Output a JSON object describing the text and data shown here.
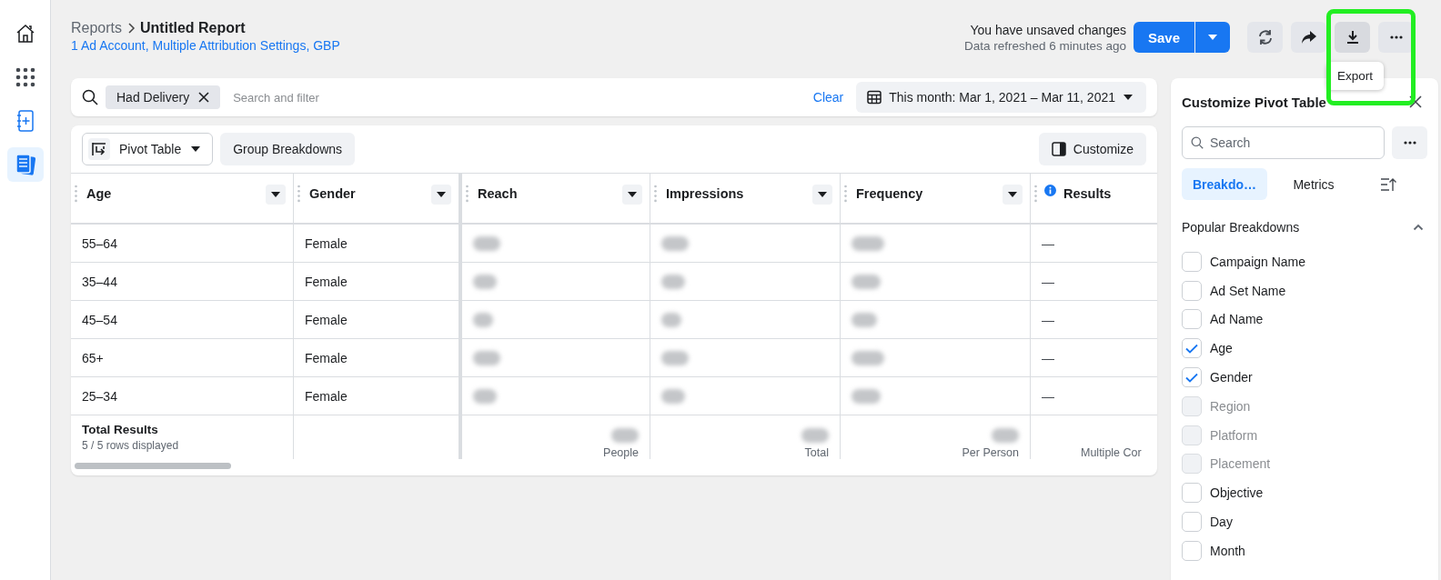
{
  "nav": [
    {
      "kind": "home",
      "selected": false
    },
    {
      "kind": "apps",
      "selected": false
    },
    {
      "kind": "notebook",
      "selected": false
    },
    {
      "kind": "reports",
      "selected": true
    }
  ],
  "header": {
    "breadcrumb_parent": "Reports",
    "breadcrumb_current": "Untitled Report",
    "subtitle": "1 Ad Account, Multiple Attribution Settings, GBP",
    "status": "You have unsaved changes",
    "refreshed": "Data refreshed 6 minutes ago",
    "save_button": "Save",
    "tooltip": "Export",
    "export_highlighted": true
  },
  "filter_bar": {
    "chip": "Had Delivery",
    "placeholder": "Search and filter",
    "clear": "Clear",
    "date_range": "This month: Mar 1, 2021 – Mar 11, 2021"
  },
  "toolbar": {
    "view": "Pivot Table",
    "group": "Group Breakdowns",
    "customize": "Customize"
  },
  "table": {
    "columns": [
      {
        "label": "Age",
        "info": false,
        "sortable": true
      },
      {
        "label": "Gender",
        "info": false,
        "sortable": true
      },
      {
        "label": "Reach",
        "info": false,
        "sortable": true
      },
      {
        "label": "Impressions",
        "info": false,
        "sortable": true
      },
      {
        "label": "Frequency",
        "info": false,
        "sortable": true
      },
      {
        "label": "Results",
        "info": true,
        "sortable": false
      }
    ],
    "rows": [
      {
        "cells": [
          {
            "kind": "text",
            "text": "55–64"
          },
          {
            "kind": "text",
            "text": "Female"
          },
          {
            "kind": "blurred"
          },
          {
            "kind": "blurred"
          },
          {
            "kind": "blurred"
          },
          {
            "kind": "text",
            "text": "—"
          }
        ]
      },
      {
        "cells": [
          {
            "kind": "text",
            "text": "35–44"
          },
          {
            "kind": "text",
            "text": "Female"
          },
          {
            "kind": "blurred"
          },
          {
            "kind": "blurred"
          },
          {
            "kind": "blurred"
          },
          {
            "kind": "text",
            "text": "—"
          }
        ]
      },
      {
        "cells": [
          {
            "kind": "text",
            "text": "45–54"
          },
          {
            "kind": "text",
            "text": "Female"
          },
          {
            "kind": "blurred"
          },
          {
            "kind": "blurred"
          },
          {
            "kind": "blurred"
          },
          {
            "kind": "text",
            "text": "—"
          }
        ]
      },
      {
        "cells": [
          {
            "kind": "text",
            "text": "65+"
          },
          {
            "kind": "text",
            "text": "Female"
          },
          {
            "kind": "blurred"
          },
          {
            "kind": "blurred"
          },
          {
            "kind": "blurred"
          },
          {
            "kind": "text",
            "text": "—"
          }
        ]
      },
      {
        "cells": [
          {
            "kind": "text",
            "text": "25–34"
          },
          {
            "kind": "text",
            "text": "Female"
          },
          {
            "kind": "blurred"
          },
          {
            "kind": "blurred"
          },
          {
            "kind": "blurred"
          },
          {
            "kind": "text",
            "text": "—"
          }
        ]
      }
    ],
    "totals": {
      "label": "Total Results",
      "note": "5 / 5 rows displayed",
      "cells": [
        {
          "blurred": true,
          "unit": "People"
        },
        {
          "blurred": true,
          "unit": "Total"
        },
        {
          "blurred": true,
          "unit": "Per Person"
        },
        {
          "blurred": false,
          "unit": "Multiple Cor"
        }
      ]
    }
  },
  "panel": {
    "title": "Customize Pivot Table",
    "search_placeholder": "Search",
    "tabs": [
      {
        "label": "Breakdo…",
        "selected": true
      },
      {
        "label": "Metrics",
        "selected": false
      }
    ],
    "section": "Popular Breakdowns",
    "expanded": true,
    "items": [
      {
        "label": "Campaign Name",
        "checked": false,
        "disabled": false
      },
      {
        "label": "Ad Set Name",
        "checked": false,
        "disabled": false
      },
      {
        "label": "Ad Name",
        "checked": false,
        "disabled": false
      },
      {
        "label": "Age",
        "checked": true,
        "disabled": false
      },
      {
        "label": "Gender",
        "checked": true,
        "disabled": false
      },
      {
        "label": "Region",
        "checked": false,
        "disabled": true
      },
      {
        "label": "Platform",
        "checked": false,
        "disabled": true
      },
      {
        "label": "Placement",
        "checked": false,
        "disabled": true
      },
      {
        "label": "Objective",
        "checked": false,
        "disabled": false
      },
      {
        "label": "Day",
        "checked": false,
        "disabled": false
      },
      {
        "label": "Month",
        "checked": false,
        "disabled": false
      }
    ]
  }
}
